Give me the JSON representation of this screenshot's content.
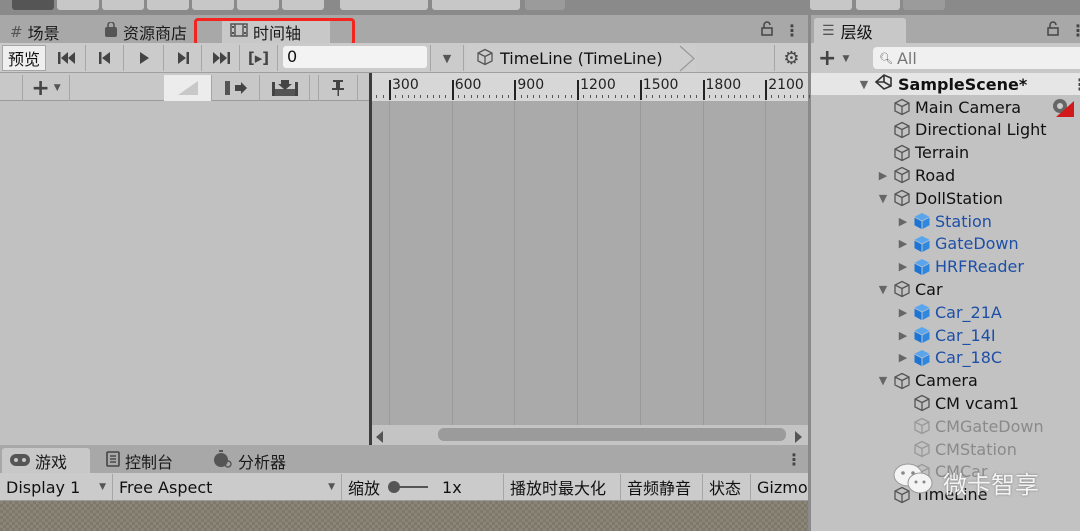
{
  "top_tabs": [
    {
      "label": "场景",
      "icon": "scene-grid-icon"
    },
    {
      "label": "资源商店",
      "icon": "asset-store-bag-icon"
    },
    {
      "label": "时间轴",
      "icon": "timeline-film-icon",
      "active": true
    }
  ],
  "timeline": {
    "preview_label": "预览",
    "frame_value": "0",
    "asset_name": "TimeLine (TimeLine)",
    "ruler_ticks": [
      "300",
      "600",
      "900",
      "1200",
      "1500",
      "1800",
      "2100"
    ],
    "highlight_color": "#f2261e"
  },
  "bottom_tabs": [
    {
      "label": "游戏",
      "icon": "gamepad-icon",
      "active": true
    },
    {
      "label": "控制台",
      "icon": "console-icon"
    },
    {
      "label": "分析器",
      "icon": "profiler-stopwatch-icon"
    }
  ],
  "game_toolbar": {
    "display": "Display 1",
    "aspect": "Free Aspect",
    "scale_label": "缩放",
    "scale_value": "1x",
    "maximize_on_play": "播放时最大化",
    "mute_audio": "音频静音",
    "stats": "状态",
    "gizmos": "Gizmo"
  },
  "hierarchy": {
    "tab_label": "层级",
    "search_placeholder": "All",
    "scene": "SampleScene*",
    "nodes": [
      {
        "label": "Main Camera",
        "depth": 1,
        "arrow": "",
        "type": "normal"
      },
      {
        "label": "Directional Light",
        "depth": 1,
        "arrow": "",
        "type": "normal"
      },
      {
        "label": "Terrain",
        "depth": 1,
        "arrow": "",
        "type": "normal"
      },
      {
        "label": "Road",
        "depth": 1,
        "arrow": "collapsed",
        "type": "normal"
      },
      {
        "label": "DollStation",
        "depth": 1,
        "arrow": "expanded",
        "type": "normal"
      },
      {
        "label": "Station",
        "depth": 2,
        "arrow": "collapsed",
        "type": "prefab"
      },
      {
        "label": "GateDown",
        "depth": 2,
        "arrow": "collapsed",
        "type": "prefab"
      },
      {
        "label": "HRFReader",
        "depth": 2,
        "arrow": "collapsed",
        "type": "prefab"
      },
      {
        "label": "Car",
        "depth": 1,
        "arrow": "expanded",
        "type": "normal"
      },
      {
        "label": "Car_21A",
        "depth": 2,
        "arrow": "collapsed",
        "type": "prefab"
      },
      {
        "label": "Car_14I",
        "depth": 2,
        "arrow": "collapsed",
        "type": "prefab"
      },
      {
        "label": "Car_18C",
        "depth": 2,
        "arrow": "collapsed",
        "type": "prefab"
      },
      {
        "label": "Camera",
        "depth": 1,
        "arrow": "expanded",
        "type": "normal"
      },
      {
        "label": "CM vcam1",
        "depth": 2,
        "arrow": "",
        "type": "normal"
      },
      {
        "label": "CMGateDown",
        "depth": 2,
        "arrow": "",
        "type": "disabled"
      },
      {
        "label": "CMStation",
        "depth": 2,
        "arrow": "",
        "type": "disabled"
      },
      {
        "label": "CMCar",
        "depth": 2,
        "arrow": "",
        "type": "disabled"
      },
      {
        "label": "TimeLine",
        "depth": 1,
        "arrow": "",
        "type": "normal"
      }
    ]
  },
  "watermark": "微卡智享"
}
